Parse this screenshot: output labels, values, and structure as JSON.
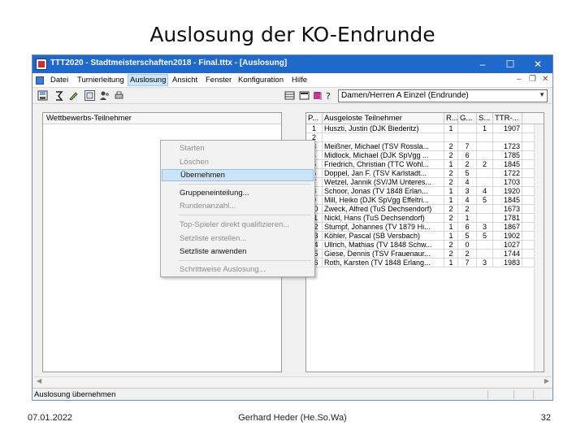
{
  "slide": {
    "title": "Auslosung der KO-Endrunde",
    "footer_date": "07.01.2022",
    "footer_author": "Gerhard Heder (He.So.Wa)",
    "page_number": "32"
  },
  "window": {
    "title": "TTT2020 - Stadtmeisterschaften2018 - Final.tttx - [Auslosung]",
    "controls": {
      "minimize": "–",
      "maximize": "☐",
      "close": "✕"
    },
    "mdi_controls": {
      "minimize": "–",
      "restore": "❐",
      "close": "✕"
    }
  },
  "menu": {
    "items": [
      "Datei",
      "Turnierleitung",
      "Auslosung",
      "Ansicht",
      "Fenster",
      "Konfiguration",
      "Hilfe"
    ],
    "active": "Auslosung"
  },
  "toolbar": {
    "competition_select": "Damen/Herren A Einzel (Endrunde)"
  },
  "dropdown": {
    "items": [
      {
        "label": "Starten",
        "enabled": false
      },
      {
        "label": "Löschen",
        "enabled": false
      },
      {
        "label": "Übernehmen",
        "enabled": true,
        "highlighted": true
      },
      {
        "label": "Gruppeneinteilung...",
        "enabled": true
      },
      {
        "label": "Rundenanzahl...",
        "enabled": false
      },
      {
        "label": "Top-Spieler direkt qualifizieren...",
        "enabled": false
      },
      {
        "label": "Setzliste erstellen...",
        "enabled": false
      },
      {
        "label": "Setzliste anwenden",
        "enabled": true
      },
      {
        "label": "Schrittweise Auslosung...",
        "enabled": false
      }
    ]
  },
  "left_panel": {
    "header": "Wettbewerbs-Teilnehmer"
  },
  "right_panel": {
    "columns": [
      "P...",
      "Ausgeloste Teilnehmer",
      "R...",
      "G...",
      "S...",
      "TTR-..."
    ],
    "rows": [
      {
        "num": "1",
        "name": "Huszti, Justin (DJK Biederitz)",
        "r": "1",
        "g": "",
        "s": "1",
        "ttr": "1907"
      },
      {
        "num": "2",
        "name": "",
        "r": "",
        "g": "",
        "s": "",
        "ttr": ""
      },
      {
        "num": "3",
        "name": "Meißner, Michael (TSV Rossla...",
        "r": "2",
        "g": "7",
        "s": "",
        "ttr": "1723"
      },
      {
        "num": "4",
        "name": "Midlock, Michael (DJK SpVgg ...",
        "r": "2",
        "g": "6",
        "s": "",
        "ttr": "1785"
      },
      {
        "num": "5",
        "name": "Friedrich, Christian (TTC Wohl...",
        "r": "1",
        "g": "2",
        "s": "2",
        "ttr": "1845"
      },
      {
        "num": "6",
        "name": "Doppel, Jan F. (TSV Karlstadt...",
        "r": "2",
        "g": "5",
        "s": "",
        "ttr": "1722"
      },
      {
        "num": "7",
        "name": "Wetzel, Jannik (SV/JM Unteres...",
        "r": "2",
        "g": "4",
        "s": "",
        "ttr": "1703"
      },
      {
        "num": "8",
        "name": "Schoor, Jonas (TV 1848 Erlan...",
        "r": "1",
        "g": "3",
        "s": "4",
        "ttr": "1920"
      },
      {
        "num": "9",
        "name": "Mill, Heiko (DJK SpVgg Effeltri...",
        "r": "1",
        "g": "4",
        "s": "5",
        "ttr": "1845"
      },
      {
        "num": "10",
        "name": "Zweck, Alfred (TuS Dechsendorf)",
        "r": "2",
        "g": "2",
        "s": "",
        "ttr": "1673"
      },
      {
        "num": "11",
        "name": "Nickl, Hans (TuS Dechsendorf)",
        "r": "2",
        "g": "1",
        "s": "",
        "ttr": "1781"
      },
      {
        "num": "12",
        "name": "Stumpf, Johannes (TV 1879 Hi...",
        "r": "1",
        "g": "6",
        "s": "3",
        "ttr": "1867"
      },
      {
        "num": "13",
        "name": "Köhler, Pascal (SB Versbach)",
        "r": "1",
        "g": "5",
        "s": "5",
        "ttr": "1902"
      },
      {
        "num": "14",
        "name": "Ullrich, Mathias (TV 1848 Schw...",
        "r": "2",
        "g": "0",
        "s": "",
        "ttr": "1027"
      },
      {
        "num": "15",
        "name": "Giese, Dennis (TSV Frauenaur...",
        "r": "2",
        "g": "2",
        "s": "",
        "ttr": "1744"
      },
      {
        "num": "16",
        "name": "Roth, Karsten (TV 1848 Erlang...",
        "r": "1",
        "g": "7",
        "s": "3",
        "ttr": "1983"
      }
    ]
  },
  "statusbar": {
    "text": "Auslosung übernehmen"
  },
  "colors": {
    "titlebar": "#1e69c9",
    "menu_highlight": "#cce4f7"
  }
}
